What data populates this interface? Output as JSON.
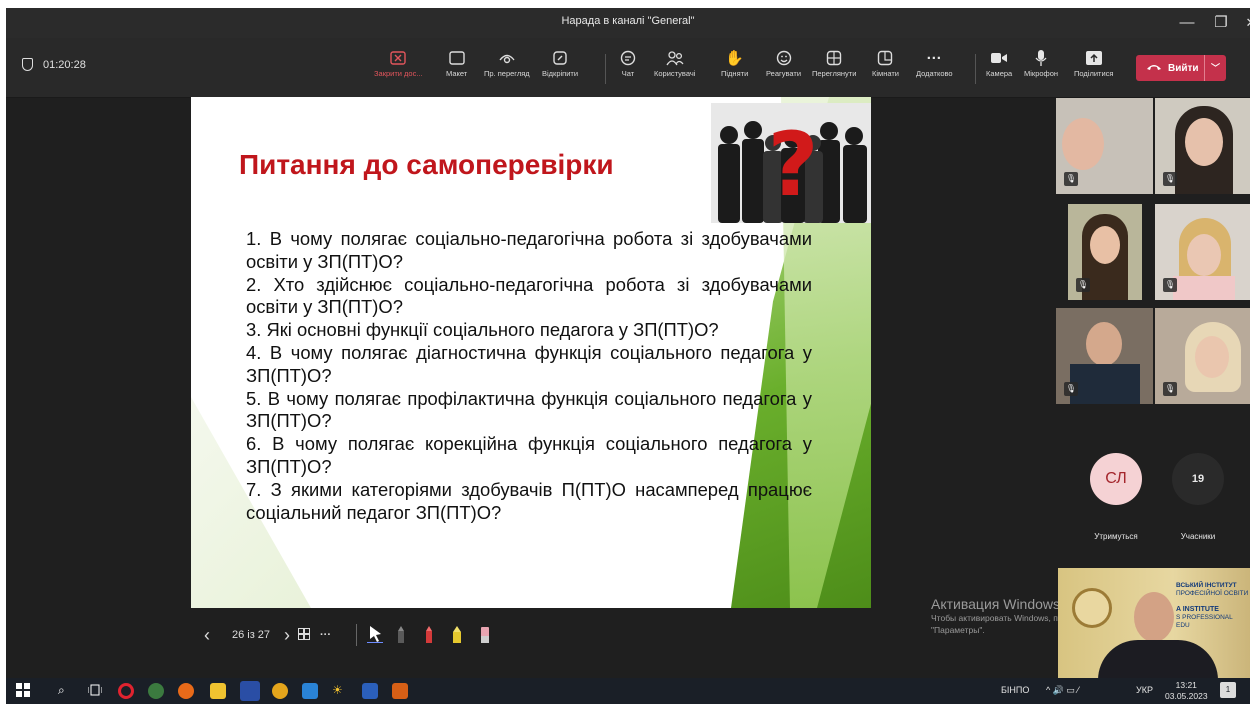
{
  "window": {
    "title": "Нарада в каналі \"General\"",
    "controls": [
      "—",
      "❐",
      "✕"
    ]
  },
  "meeting": {
    "timer": "01:20:28"
  },
  "toolbar": {
    "buttons": [
      {
        "label": "Закрити дос...",
        "icon": "close-share-icon"
      },
      {
        "label": "Макет",
        "icon": "layout-icon"
      },
      {
        "label": "Пр. перегляд",
        "icon": "preview-icon"
      },
      {
        "label": "Відкріпити",
        "icon": "unpin-icon"
      },
      {
        "label": "Чат",
        "icon": "chat-icon"
      },
      {
        "label": "Користувачі",
        "icon": "people-icon"
      },
      {
        "label": "Підняти",
        "icon": "raise-hand-icon"
      },
      {
        "label": "Реагувати",
        "icon": "react-icon"
      },
      {
        "label": "Переглянути",
        "icon": "view-icon"
      },
      {
        "label": "Кімнати",
        "icon": "rooms-icon"
      },
      {
        "label": "Додатково",
        "icon": "more-icon"
      },
      {
        "label": "Камера",
        "icon": "camera-icon"
      },
      {
        "label": "Мікрофон",
        "icon": "mic-icon"
      },
      {
        "label": "Поділитися",
        "icon": "share-icon"
      }
    ],
    "leave_label": "Вийти"
  },
  "slide": {
    "title": "Питання до самоперевірки",
    "questions": [
      "1. В чому полягає соціально-педагогічна робота зі здобувачами освіти у ЗП(ПТ)О?",
      "2. Хто здійснює соціально-педагогічна робота зі здобувачами освіти у ЗП(ПТ)О?",
      "3. Які основні функції соціального педагога у ЗП(ПТ)О?",
      "4. В чому полягає діагностична функція соціального педагога у ЗП(ПТ)О?",
      "5. В чому полягає профілактична функція соціального педагога у ЗП(ПТ)О?",
      "6. В чому полягає корекційна функція соціального педагога у ЗП(ПТ)О?",
      "7. З якими категоріями здобувачів П(ПТ)О насамперед працює соціальний педагог ЗП(ПТ)О?"
    ]
  },
  "slide_controls": {
    "page": "26 із 27",
    "prev": "‹",
    "next": "›",
    "more": "···"
  },
  "participants": {
    "avatar_initials": "СЛ",
    "avatar_label": "Утримуться",
    "count": "19",
    "count_label": "Учасники"
  },
  "watermark": {
    "title": "Активация Windows",
    "line1": "Чтобы активировать Windows, перейдите в раздел",
    "line2": "\"Параметры\"."
  },
  "selfview": {
    "line1": "ВСЬКИЙ ІНСТИТУТ",
    "line2": "ПРОФЕСІЙНОЇ ОСВІТИ",
    "line3": "A INSTITUTE",
    "line4": "S PROFESSIONAL",
    "line5": "EDU"
  },
  "taskbar": {
    "lang1": "БІНПО",
    "lang2": "УКР",
    "time": "13:21",
    "date": "03.05.2023",
    "notif": "1"
  },
  "colors": {
    "leave": "#c4314b",
    "slide_title": "#c0161c",
    "avatar_bg": "#f5d2d4",
    "avatar_text": "#a4262c"
  }
}
